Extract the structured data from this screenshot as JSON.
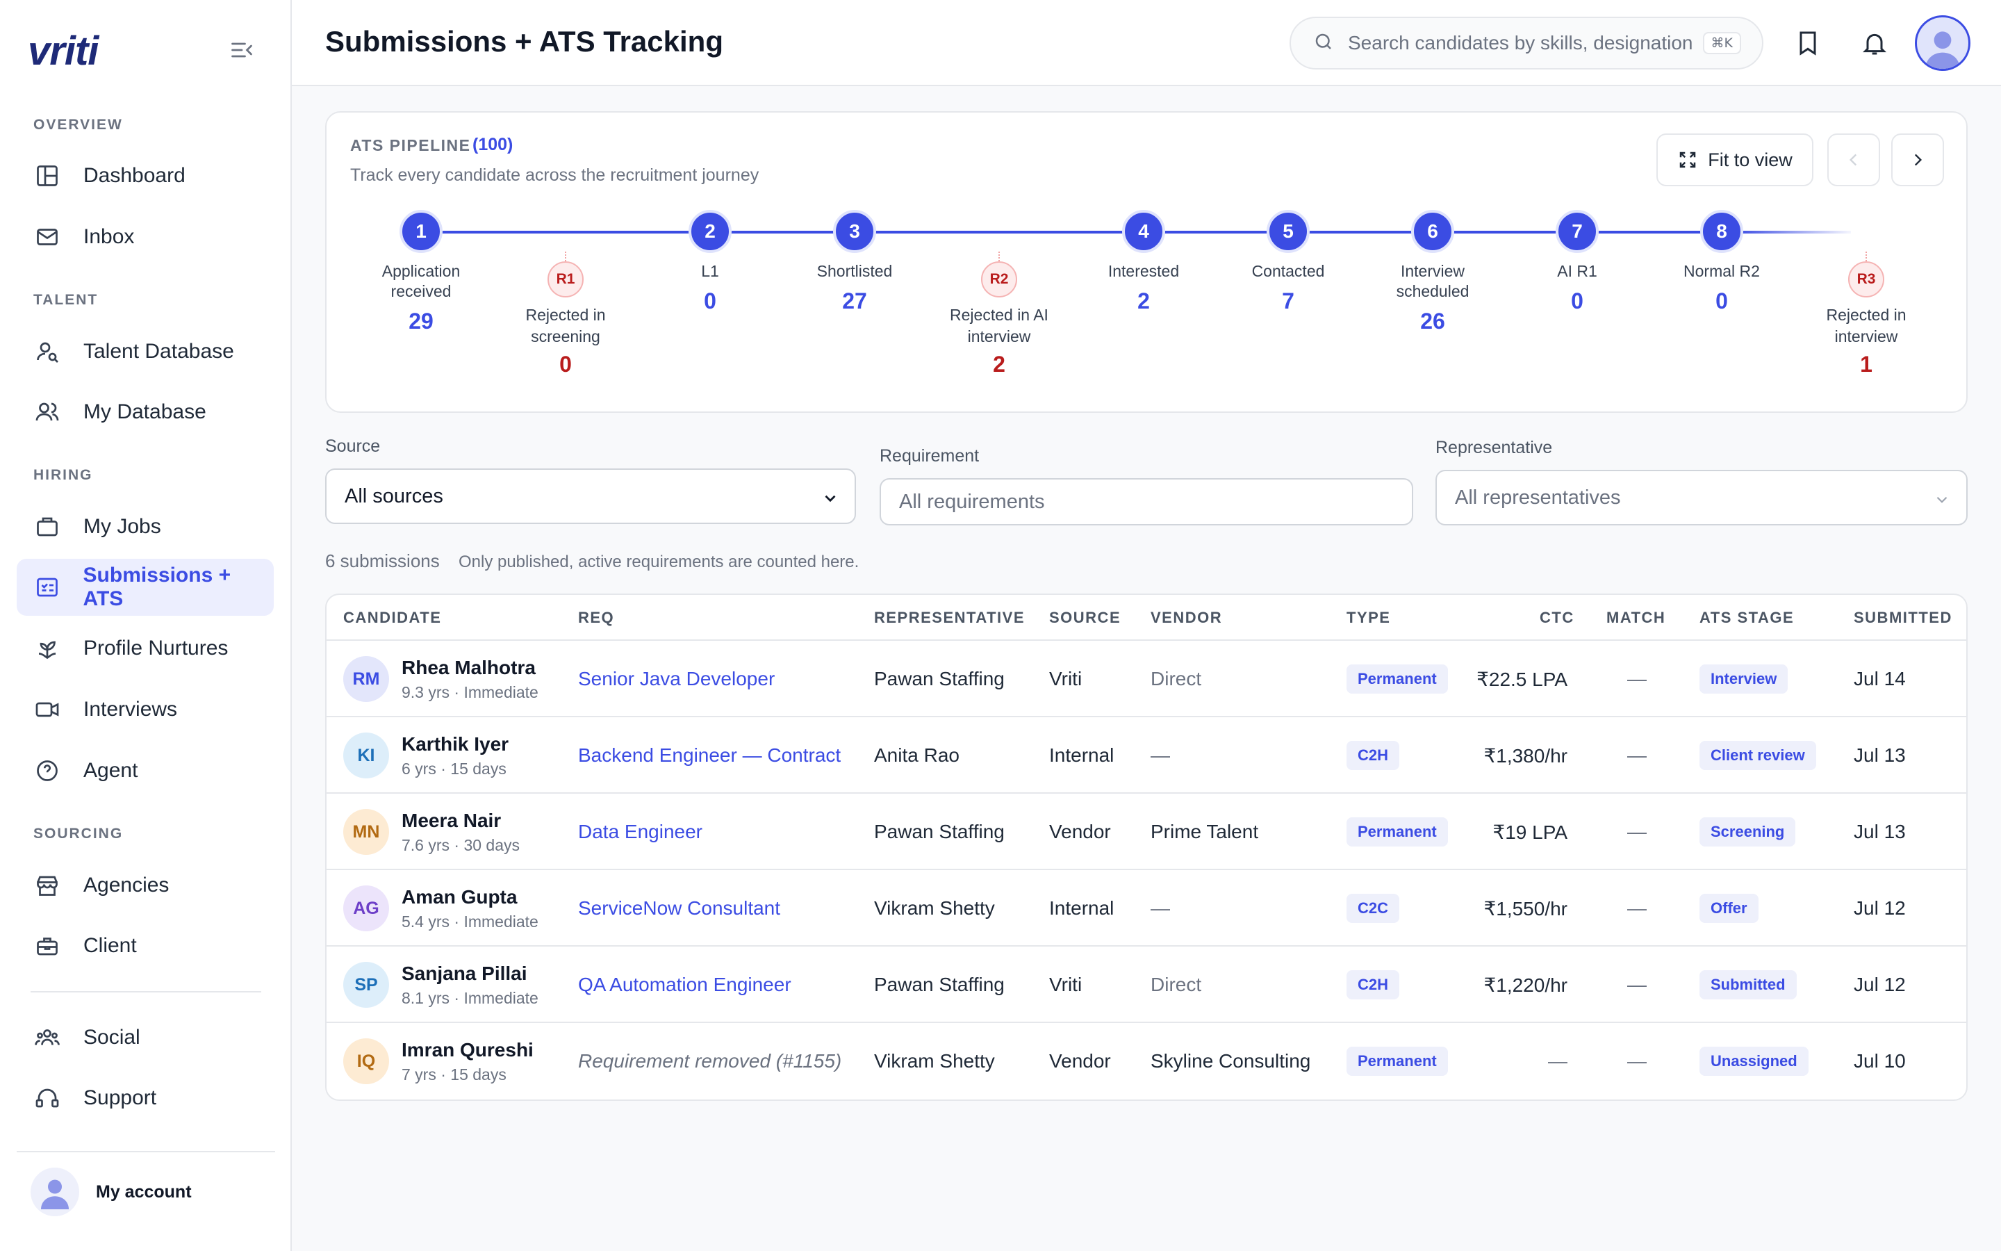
{
  "sidebar": {
    "logo": "vriti",
    "sections": {
      "overview": "OVERVIEW",
      "talent": "TALENT",
      "hiring": "HIRING",
      "sourcing": "SOURCING"
    },
    "items": {
      "dashboard": "Dashboard",
      "inbox": "Inbox",
      "talent_database": "Talent Database",
      "my_database": "My Database",
      "my_jobs": "My Jobs",
      "submissions": "Submissions + ATS",
      "profile_nurtures": "Profile Nurtures",
      "interviews": "Interviews",
      "agent": "Agent",
      "agencies": "Agencies",
      "client": "Client",
      "social": "Social",
      "support": "Support"
    },
    "account_label": "My account"
  },
  "header": {
    "title": "Submissions + ATS Tracking",
    "search_placeholder": "Search candidates by skills, designation",
    "search_shortcut": "⌘K"
  },
  "pipeline": {
    "title": "ATS PIPELINE",
    "count": "(100)",
    "subtitle": "Track every candidate across the recruitment journey",
    "fit_label": "Fit to view",
    "stages": [
      {
        "num": "1",
        "label": "Application received",
        "count": "29"
      },
      {
        "num": "2",
        "label": "L1",
        "count": "0"
      },
      {
        "num": "3",
        "label": "Shortlisted",
        "count": "27"
      },
      {
        "num": "4",
        "label": "Interested",
        "count": "2"
      },
      {
        "num": "5",
        "label": "Contacted",
        "count": "7"
      },
      {
        "num": "6",
        "label": "Interview scheduled",
        "count": "26"
      },
      {
        "num": "7",
        "label": "AI R1",
        "count": "0"
      },
      {
        "num": "8",
        "label": "Normal R2",
        "count": "0"
      }
    ],
    "rejections": [
      {
        "badge": "R1",
        "label": "Rejected in screening",
        "count": "0"
      },
      {
        "badge": "R2",
        "label": "Rejected in AI interview",
        "count": "2"
      },
      {
        "badge": "R3",
        "label": "Rejected in interview",
        "count": "1"
      }
    ]
  },
  "filters": {
    "source_label": "Source",
    "source_value": "All sources",
    "requirement_label": "Requirement",
    "requirement_placeholder": "All requirements",
    "representative_label": "Representative",
    "representative_value": "All representatives"
  },
  "summary": {
    "count": "6 submissions",
    "note": "Only published, active requirements are counted here."
  },
  "table": {
    "headers": {
      "candidate": "CANDIDATE",
      "req": "REQ",
      "representative": "REPRESENTATIVE",
      "source": "SOURCE",
      "vendor": "VENDOR",
      "type": "TYPE",
      "ctc": "CTC",
      "match": "MATCH",
      "stage": "ATS STAGE",
      "submitted": "SUBMITTED"
    },
    "rows": [
      {
        "initials": "RM",
        "name": "Rhea Malhotra",
        "meta": "9.3 yrs · Immediate",
        "req": "Senior Java Developer",
        "rep": "Pawan Staffing",
        "source": "Vriti",
        "vendor": "Direct",
        "type": "Permanent",
        "ctc": "₹22.5 LPA",
        "match": "—",
        "stage": "Interview",
        "submitted": "Jul 14"
      },
      {
        "initials": "KI",
        "name": "Karthik Iyer",
        "meta": "6 yrs · 15 days",
        "req": "Backend Engineer — Contract",
        "rep": "Anita Rao",
        "source": "Internal",
        "vendor": "—",
        "type": "C2H",
        "ctc": "₹1,380/hr",
        "match": "—",
        "stage": "Client review",
        "submitted": "Jul 13"
      },
      {
        "initials": "MN",
        "name": "Meera Nair",
        "meta": "7.6 yrs · 30 days",
        "req": "Data Engineer",
        "rep": "Pawan Staffing",
        "source": "Vendor",
        "vendor": "Prime Talent",
        "type": "Permanent",
        "ctc": "₹19 LPA",
        "match": "—",
        "stage": "Screening",
        "submitted": "Jul 13"
      },
      {
        "initials": "AG",
        "name": "Aman Gupta",
        "meta": "5.4 yrs · Immediate",
        "req": "ServiceNow Consultant",
        "rep": "Vikram Shetty",
        "source": "Internal",
        "vendor": "—",
        "type": "C2C",
        "ctc": "₹1,550/hr",
        "match": "—",
        "stage": "Offer",
        "submitted": "Jul 12"
      },
      {
        "initials": "SP",
        "name": "Sanjana Pillai",
        "meta": "8.1 yrs · Immediate",
        "req": "QA Automation Engineer",
        "rep": "Pawan Staffing",
        "source": "Vriti",
        "vendor": "Direct",
        "type": "C2H",
        "ctc": "₹1,220/hr",
        "match": "—",
        "stage": "Submitted",
        "submitted": "Jul 12"
      },
      {
        "initials": "IQ",
        "name": "Imran Qureshi",
        "meta": "7 yrs · 15 days",
        "req": "Requirement removed (#1155)",
        "rep": "Vikram Shetty",
        "source": "Vendor",
        "vendor": "Skyline Consulting",
        "type": "Permanent",
        "ctc": "—",
        "match": "—",
        "stage": "Unassigned",
        "submitted": "Jul 10"
      }
    ]
  }
}
